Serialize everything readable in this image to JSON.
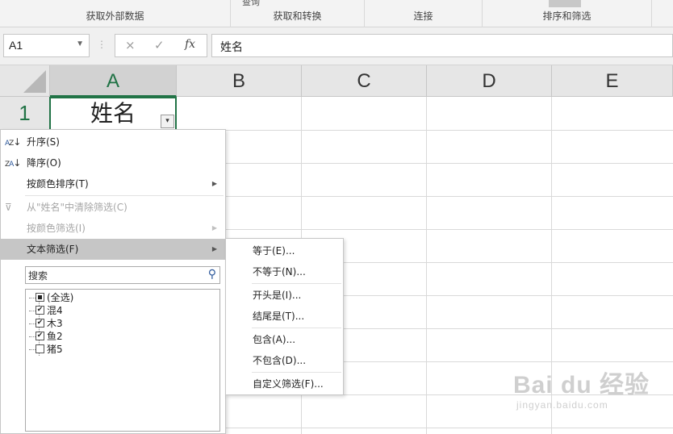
{
  "ribbon": {
    "groups": [
      {
        "label": "获取外部数据"
      },
      {
        "label": "获取和转换"
      },
      {
        "label": "连接"
      },
      {
        "label": "排序和筛选"
      }
    ],
    "cut_text": "查询"
  },
  "formula_bar": {
    "name_box": "A1",
    "cancel_icon": "×",
    "enter_icon": "✓",
    "fx_label": "fx",
    "content": "姓名"
  },
  "grid": {
    "columns": [
      "A",
      "B",
      "C",
      "D",
      "E"
    ],
    "rows": [
      "1"
    ],
    "cell_a1": "姓名",
    "filter_button": "▾"
  },
  "filter_menu": {
    "items": [
      {
        "label": "升序(S)",
        "icon": "A↓Z",
        "disabled": false
      },
      {
        "label": "降序(O)",
        "icon": "Z↓A",
        "disabled": false
      },
      {
        "label": "按颜色排序(T)",
        "submenu": true,
        "disabled": false
      },
      {
        "label": "从\"姓名\"中清除筛选(C)",
        "icon": "clear-filter",
        "disabled": true
      },
      {
        "label": "按颜色筛选(I)",
        "submenu": true,
        "disabled": true
      },
      {
        "label": "文本筛选(F)",
        "submenu": true,
        "disabled": false,
        "active": true
      }
    ],
    "search_placeholder": "搜索",
    "checklist": [
      {
        "label": "(全选)",
        "state": "partial"
      },
      {
        "label": "混4",
        "state": "checked"
      },
      {
        "label": "木3",
        "state": "checked"
      },
      {
        "label": "鱼2",
        "state": "checked"
      },
      {
        "label": "猪5",
        "state": "unchecked"
      }
    ]
  },
  "text_filter_submenu": {
    "items": [
      {
        "label": "等于(E)..."
      },
      {
        "label": "不等于(N)..."
      },
      {
        "label": "开头是(I)..."
      },
      {
        "label": "结尾是(T)..."
      },
      {
        "label": "包含(A)..."
      },
      {
        "label": "不包含(D)..."
      },
      {
        "label": "自定义筛选(F)..."
      }
    ]
  },
  "watermark": {
    "brand": "Bai du 经验",
    "url": "jingyan.baidu.com"
  },
  "colors": {
    "accent": "#217346",
    "menu_active": "#c6c6c6",
    "disabled_text": "#a6a6a6"
  }
}
